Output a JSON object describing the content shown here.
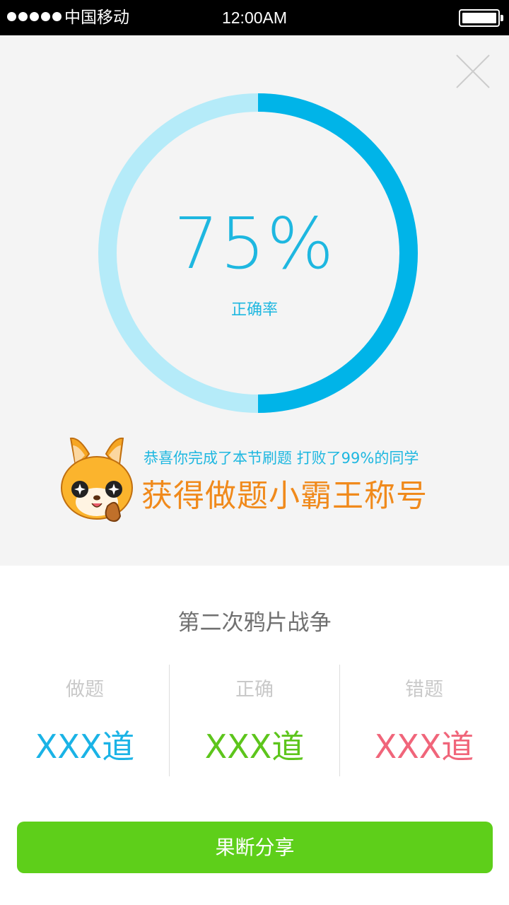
{
  "status_bar": {
    "carrier": "中国移动",
    "time": "12:00AM",
    "signal_dots": 5,
    "battery_level": 1.0
  },
  "result": {
    "percent_text": "75%",
    "percent_value": 75,
    "label": "正确率",
    "colors": {
      "progress": "#00b4e8",
      "track": "#b5ebf9",
      "text": "#1eb7e0"
    }
  },
  "achievement": {
    "congrats": "恭喜你完成了本节刷题  打败了99%的同学",
    "title": "获得做题小霸王称号",
    "title_color": "#f08a1c",
    "mascot_icon": "fox-mascot-thumbs-up"
  },
  "lesson": {
    "title": "第二次鸦片战争"
  },
  "stats": [
    {
      "label": "做题",
      "value": "XXX道",
      "color": "#1ab3e6"
    },
    {
      "label": "正确",
      "value": "XXX道",
      "color": "#5dc51c"
    },
    {
      "label": "错题",
      "value": "XXX道",
      "color": "#f0657a"
    }
  ],
  "share": {
    "label": "果断分享",
    "color": "#5ecf1a"
  },
  "close_icon": "close-icon"
}
